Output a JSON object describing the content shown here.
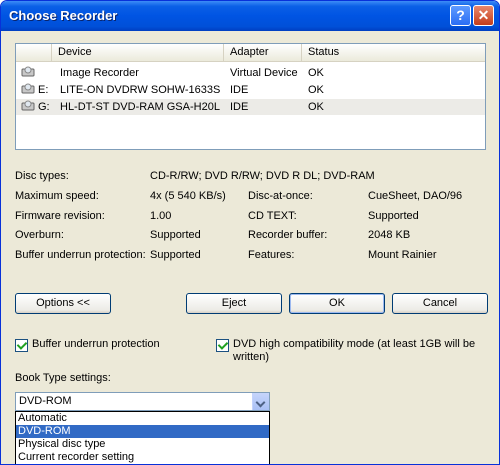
{
  "window": {
    "title": "Choose Recorder"
  },
  "listview": {
    "columns": [
      "Device",
      "Adapter",
      "Status"
    ],
    "rows": [
      {
        "drive": "",
        "device": "Image Recorder",
        "adapter": "Virtual Device",
        "status": "OK"
      },
      {
        "drive": "E:",
        "device": "LITE-ON DVDRW SOHW-1633S",
        "adapter": "IDE",
        "status": "OK"
      },
      {
        "drive": "G:",
        "device": "HL-DT-ST DVD-RAM GSA-H20L",
        "adapter": "IDE",
        "status": "OK"
      }
    ]
  },
  "info": {
    "disc_types_label": "Disc types:",
    "disc_types_value": "CD-R/RW; DVD R/RW; DVD R DL; DVD-RAM",
    "max_speed_label": "Maximum speed:",
    "max_speed_value": "4x (5 540 KB/s)",
    "dao_label": "Disc-at-once:",
    "dao_value": "CueSheet, DAO/96",
    "firmware_label": "Firmware revision:",
    "firmware_value": "1.00",
    "cdtext_label": "CD TEXT:",
    "cdtext_value": "Supported",
    "overburn_label": "Overburn:",
    "overburn_value": "Supported",
    "recbuffer_label": "Recorder buffer:",
    "recbuffer_value": "2048 KB",
    "bufunder_label": "Buffer underrun protection:",
    "bufunder_value": "Supported",
    "features_label": "Features:",
    "features_value": "Mount Rainier"
  },
  "buttons": {
    "options": "Options <<",
    "eject": "Eject",
    "ok": "OK",
    "cancel": "Cancel"
  },
  "checkboxes": {
    "buffer_underrun": "Buffer underrun protection",
    "dvd_compat_line1": "DVD high compatibility mode (at least 1GB will be",
    "dvd_compat_line2": "written)"
  },
  "book_type": {
    "label": "Book Type settings:",
    "selected": "DVD-ROM",
    "options": [
      "Automatic",
      "DVD-ROM",
      "Physical disc type",
      "Current recorder setting"
    ]
  }
}
